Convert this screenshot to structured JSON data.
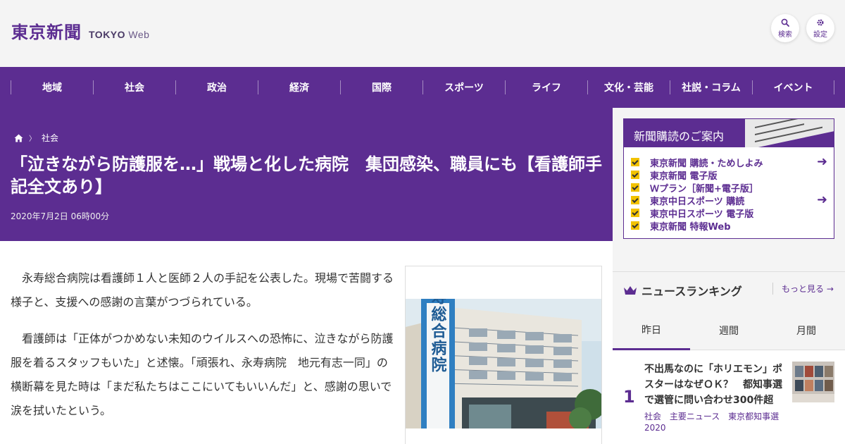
{
  "header": {
    "logo_jp": "東京新聞",
    "logo_en_bold": "TOKYO",
    "logo_en_light": "Web",
    "search_label": "検索",
    "settings_label": "設定"
  },
  "nav": {
    "items": [
      "地域",
      "社会",
      "政治",
      "経済",
      "国際",
      "スポーツ",
      "ライフ",
      "文化・芸能",
      "社説・コラム",
      "イベント"
    ]
  },
  "breadcrumb": {
    "category": "社会"
  },
  "article": {
    "headline": "「泣きながら防護服を…」戦場と化した病院　集団感染、職員にも【看護師手記全文あり】",
    "date": "2020年7月2日 06時00分",
    "paragraphs": [
      "永寿総合病院は看護師１人と医師２人の手記を公表した。現場で苦闘する様子と、支援への感謝の言葉がつづられている。",
      "看護師は「正体がつかめない未知のウイルスへの恐怖に、泣きながら防護服を着るスタッフもいた」と述懐。「頑張れ、永寿病院　地元有志一同」の横断幕を見た時は「まだ私たちはここにいてもいいんだ」と、感謝の思いで涙を拭いたという。"
    ],
    "photo_sign": "永寿総合病院"
  },
  "subscription": {
    "title": "新聞購読のご案内",
    "items": [
      {
        "label": "東京新聞 購読・ためしよみ",
        "login": true
      },
      {
        "label": "東京新聞 電子版",
        "login": false
      },
      {
        "label": "Ｗプラン［新聞+電子版］",
        "login": false
      },
      {
        "label": "東京中日スポーツ 購読",
        "login": true
      },
      {
        "label": "東京中日スポーツ 電子版",
        "login": false
      },
      {
        "label": "東京新聞 特報Web",
        "login": false
      }
    ]
  },
  "ranking": {
    "title": "ニュースランキング",
    "more_label": "もっと見る",
    "tabs": [
      "昨日",
      "週間",
      "月間"
    ],
    "active_tab": "昨日",
    "top_item": {
      "rank": "1",
      "title": "不出馬なのに「ホリエモン」ポスターはなぜＯＫ？　都知事選で選管に問い合わせ300件超",
      "tags": [
        "社会",
        "主要ニュース",
        "東京都知事選2020"
      ]
    }
  },
  "colors": {
    "brand": "#5c2d91",
    "accent_yellow": "#f2c200"
  }
}
